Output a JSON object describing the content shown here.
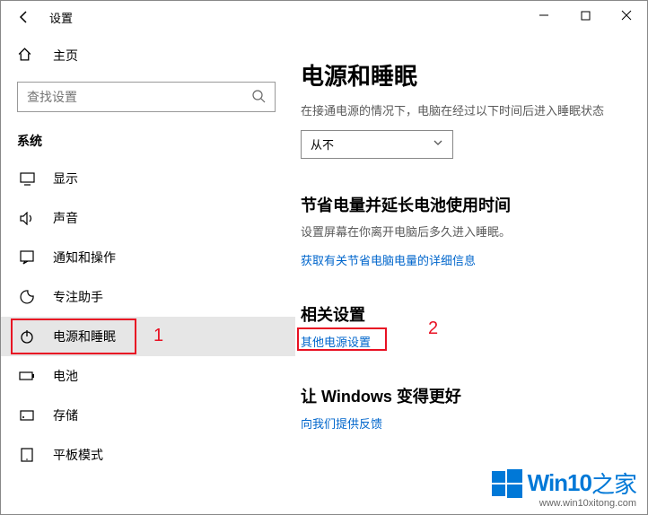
{
  "window": {
    "title": "设置"
  },
  "sidebar": {
    "home_label": "主页",
    "search_placeholder": "查找设置",
    "category_header": "系统",
    "items": [
      {
        "label": "显示"
      },
      {
        "label": "声音"
      },
      {
        "label": "通知和操作"
      },
      {
        "label": "专注助手"
      },
      {
        "label": "电源和睡眠"
      },
      {
        "label": "电池"
      },
      {
        "label": "存储"
      },
      {
        "label": "平板模式"
      }
    ]
  },
  "main": {
    "heading": "电源和睡眠",
    "description": "在接通电源的情况下，电脑在经过以下时间后进入睡眠状态",
    "select_value": "从不",
    "save_heading": "节省电量并延长电池使用时间",
    "save_sub": "设置屏幕在你离开电脑后多久进入睡眠。",
    "save_link": "获取有关节省电脑电量的详细信息",
    "related_heading": "相关设置",
    "related_link": "其他电源设置",
    "better_heading": "让 Windows 变得更好",
    "feedback_link": "向我们提供反馈"
  },
  "annotations": {
    "one": "1",
    "two": "2"
  },
  "watermark": {
    "brand_prefix": "Win10",
    "brand_suffix": "之家",
    "url": "www.win10xitong.com"
  }
}
